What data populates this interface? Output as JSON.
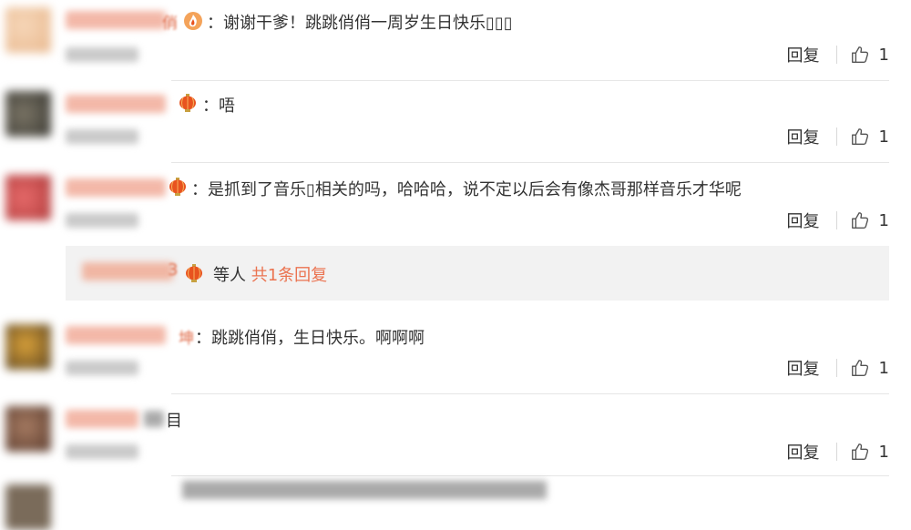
{
  "comments": [
    {
      "name_tail": "俏",
      "text": "：谢谢干爹！跳跳俏俏一周岁生日快乐▯▯▯",
      "badge": "flame",
      "reply_label": "回复",
      "likes": "1"
    },
    {
      "name_tail": "",
      "text": "：唔",
      "badge": "lantern",
      "reply_label": "回复",
      "likes": "1"
    },
    {
      "name_tail": "",
      "text": "：是抓到了音乐▯相关的吗，哈哈哈，说不定以后会有像杰哥那样音乐才华呢",
      "badge": "lantern",
      "reply_label": "回复",
      "likes": "1"
    },
    {
      "name_tail": "坤",
      "text": "：跳跳俏俏，生日快乐。啊啊啊",
      "badge": "none",
      "reply_label": "回复",
      "likes": "1"
    },
    {
      "name_tail": "",
      "text": "目",
      "badge": "none",
      "reply_label": "回复",
      "likes": "1"
    }
  ],
  "subreply": {
    "name_tail": "3",
    "suffix": "等人",
    "link": "共1条回复"
  },
  "colors": {
    "link": "#eb7350",
    "lantern": "#e8531f"
  }
}
